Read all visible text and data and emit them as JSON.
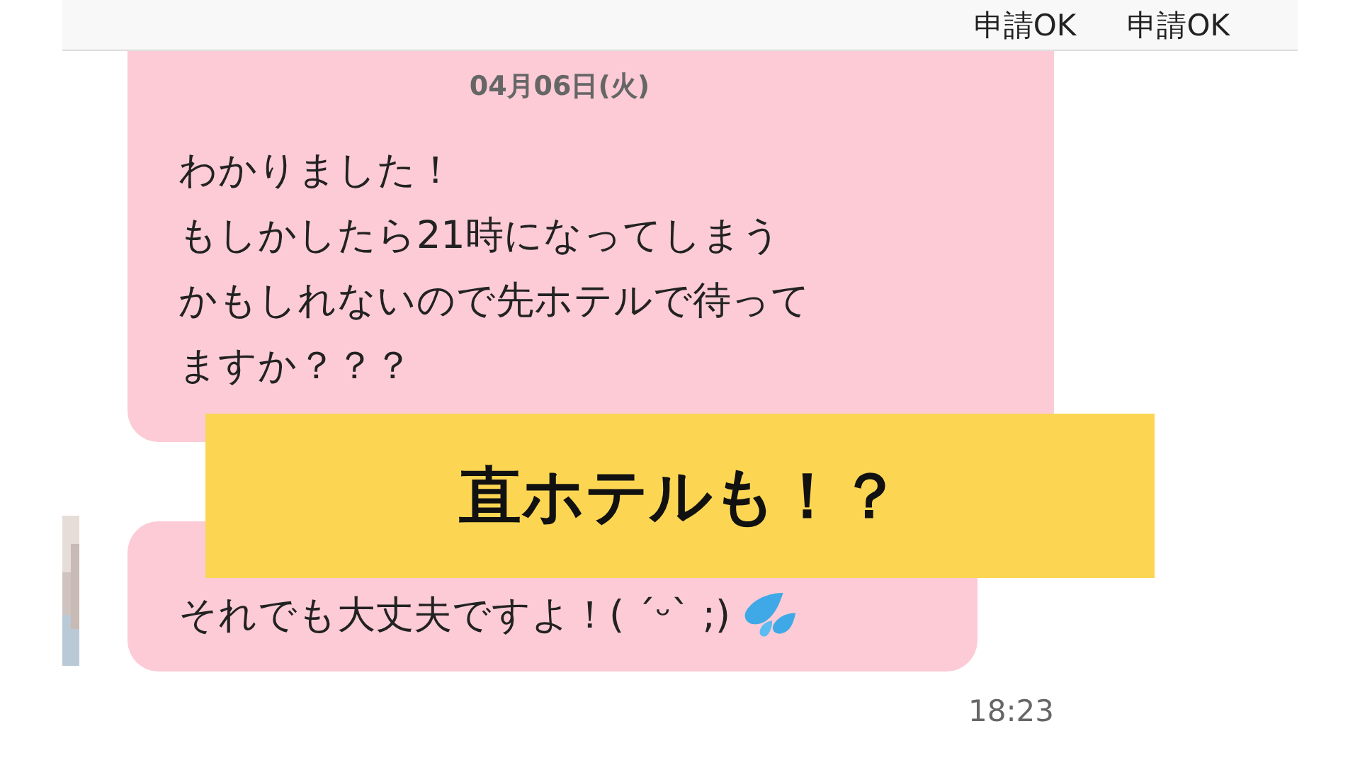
{
  "header": {
    "actions": [
      "申請OK",
      "申請OK"
    ]
  },
  "messages": [
    {
      "kind": "incoming",
      "date": "04月06日(火)",
      "lines": [
        "わかりました！",
        "もしかしたら21時になってしまう",
        "かもしれないので先ホテルで待って",
        "ますか？？？"
      ],
      "avatar": false
    },
    {
      "kind": "incoming",
      "lines": [
        "それでも大丈夫ですよ！( ´ᵕ` ;)"
      ],
      "avatar": true,
      "time": "18:23"
    }
  ],
  "banner": {
    "text": "直ホテルも！？"
  }
}
